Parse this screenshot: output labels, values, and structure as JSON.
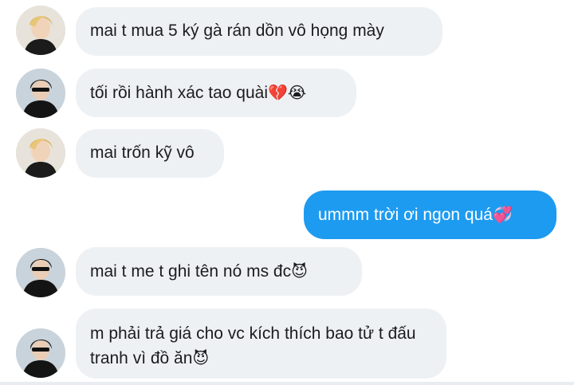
{
  "conversation": {
    "messages": [
      {
        "sender": "contact-a",
        "text": "mai t mua 5 ký gà rán dồn vô họng mày",
        "emoji": ""
      },
      {
        "sender": "contact-b",
        "text": "tối rồi hành xác tao quài",
        "emoji": "💔😭"
      },
      {
        "sender": "contact-a",
        "text": "mai trốn kỹ vô",
        "emoji": ""
      },
      {
        "sender": "me",
        "text": "ummm trời ơi ngon quá",
        "emoji": "💞"
      },
      {
        "sender": "contact-b",
        "text": "mai t me t ghi tên nó ms đc",
        "emoji": "😈"
      },
      {
        "sender": "contact-b",
        "text": "m phải trả giá cho vc kích thích bao tử t đấu tranh vì đồ ăn",
        "emoji": "😈"
      }
    ]
  },
  "colors": {
    "incoming_bubble": "#eef1f4",
    "outgoing_bubble": "#1d9bf0",
    "text": "#1c1c1c"
  }
}
